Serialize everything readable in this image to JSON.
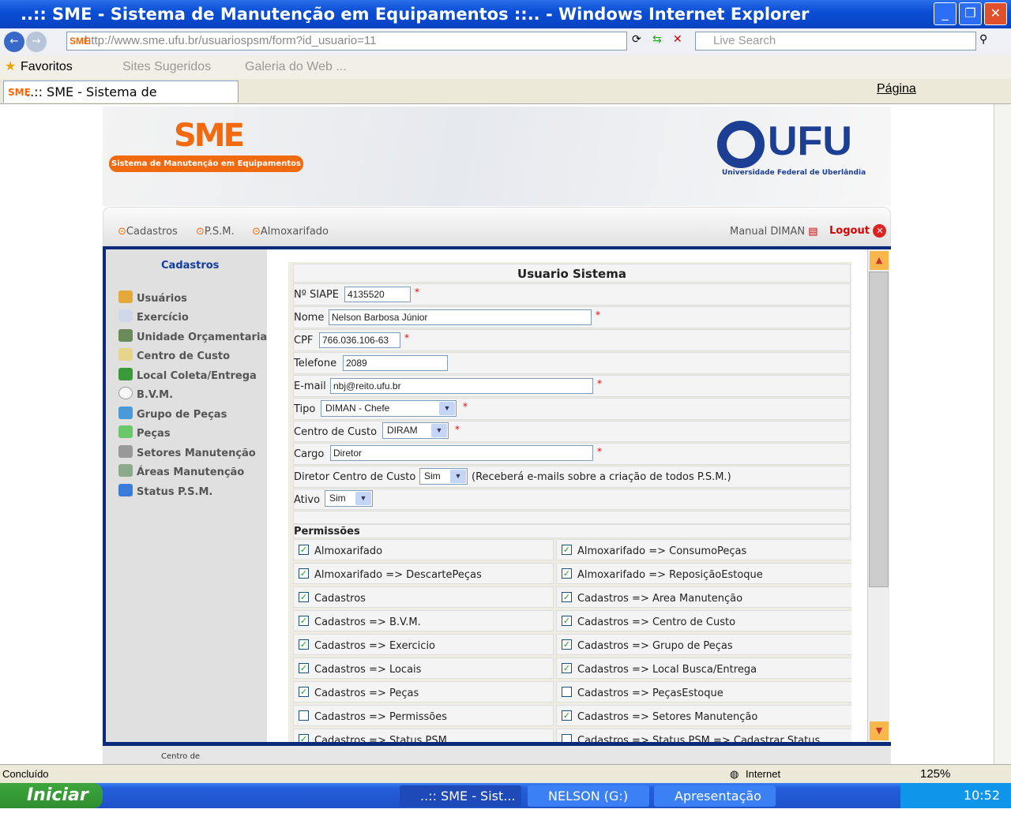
{
  "window": {
    "title": "..:: SME - Sistema de Manutenção em Equipamentos ::.. - Windows Internet Explorer"
  },
  "browser": {
    "url": "http://www.sme.ufu.br/usuariospsm/form?id_usuario=11",
    "search_placeholder": "Live Search",
    "favorites": "Favoritos",
    "sites_sugeridos": "Sites Sugeridos",
    "galeria": "Galeria do Web ...",
    "tab_title": "..:: SME - Sistema de Manutenção e...",
    "page_menu": "Página",
    "status": "Concluído",
    "zone": "Internet",
    "zoom": "125%"
  },
  "banner": {
    "logo": "SME",
    "subtitle": "Sistema de Manutenção em Equipamentos",
    "ufu": "UFU",
    "ufu_sub": "Universidade Federal de Uberlândia"
  },
  "nav": {
    "items": [
      "Cadastros",
      "P.S.M.",
      "Almoxarifado"
    ],
    "manual": "Manual DIMAN",
    "logout": "Logout"
  },
  "sidebar": {
    "title": "Cadastros",
    "items": [
      "Usuários",
      "Exercício",
      "Unidade Orçamentaria",
      "Centro de Custo",
      "Local Coleta/Entrega",
      "B.V.M.",
      "Grupo de Peças",
      "Peças",
      "Setores Manutenção",
      "Áreas Manutenção",
      "Status P.S.M."
    ]
  },
  "form": {
    "title": "Usuario Sistema",
    "siape": {
      "label": "Nº SIAPE",
      "value": "4135520"
    },
    "nome": {
      "label": "Nome",
      "value": "Nelson Barbosa Júnior"
    },
    "cpf": {
      "label": "CPF",
      "value": "766.036.106-63"
    },
    "telefone": {
      "label": "Telefone",
      "value": "2089"
    },
    "email": {
      "label": "E-mail",
      "value": "nbj@reito.ufu.br"
    },
    "tipo": {
      "label": "Tipo",
      "value": "DIMAN - Chefe"
    },
    "centro": {
      "label": "Centro de Custo",
      "value": "DIRAM"
    },
    "cargo": {
      "label": "Cargo",
      "value": "Diretor"
    },
    "diretor": {
      "label": "Diretor Centro de Custo",
      "value": "Sim",
      "note": "(Receberá e-mails sobre a criação de todos P.S.M.)"
    },
    "ativo": {
      "label": "Ativo",
      "value": "Sim"
    },
    "required_mark": "*",
    "permissions_title": "Permissões",
    "permissions": [
      {
        "label": "Almoxarifado",
        "checked": true
      },
      {
        "label": "Almoxarifado => ConsumoPeças",
        "checked": true
      },
      {
        "label": "Almoxarifado => DescartePeças",
        "checked": true
      },
      {
        "label": "Almoxarifado => ReposiçãoEstoque",
        "checked": true
      },
      {
        "label": "Cadastros",
        "checked": true
      },
      {
        "label": "Cadastros => Area Manutenção",
        "checked": true
      },
      {
        "label": "Cadastros => B.V.M.",
        "checked": true
      },
      {
        "label": "Cadastros => Centro de Custo",
        "checked": true
      },
      {
        "label": "Cadastros => Exercicio",
        "checked": true
      },
      {
        "label": "Cadastros => Grupo de Peças",
        "checked": true
      },
      {
        "label": "Cadastros => Locais",
        "checked": true
      },
      {
        "label": "Cadastros => Local Busca/Entrega",
        "checked": true
      },
      {
        "label": "Cadastros => Peças",
        "checked": true
      },
      {
        "label": "Cadastros => PeçasEstoque",
        "checked": false
      },
      {
        "label": "Cadastros => Permissões",
        "checked": false
      },
      {
        "label": "Cadastros => Setores Manutenção",
        "checked": true
      },
      {
        "label": "Cadastros => Status PSM",
        "checked": true
      },
      {
        "label": "Cadastros => Status PSM => Cadastrar Status",
        "checked": false
      }
    ]
  },
  "footer": {
    "text": "Centro de"
  },
  "taskbar": {
    "start": "Iniciar",
    "tasks": [
      "..:: SME - Sist...",
      "NELSON (G:)",
      "Apresentação ..."
    ],
    "clock": "10:52"
  }
}
